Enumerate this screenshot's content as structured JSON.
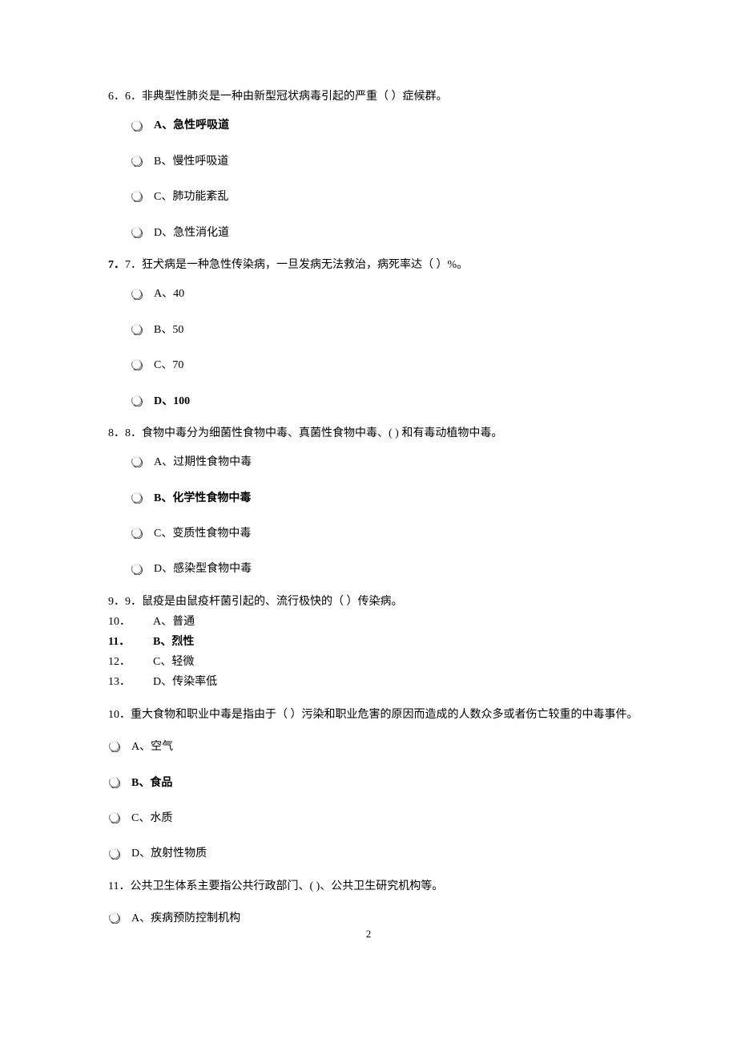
{
  "q6": {
    "text": "6．6．非典型性肺炎是一种由新型冠状病毒引起的严重（ ）症候群。",
    "options": [
      {
        "label": "A、急性呼吸道",
        "bold": true
      },
      {
        "label": "B、慢性呼吸道",
        "bold": false
      },
      {
        "label": "C、肺功能紊乱",
        "bold": false
      },
      {
        "label": "D、急性消化道",
        "bold": false
      }
    ]
  },
  "q7": {
    "text": "7．7．狂犬病是一种急性传染病，一旦发病无法救治，病死率达（  ）%。",
    "options": [
      {
        "label": "A、40",
        "bold": false
      },
      {
        "label": "B、50",
        "bold": false
      },
      {
        "label": "C、70",
        "bold": false
      },
      {
        "label": "D、100",
        "bold": true
      }
    ]
  },
  "q8": {
    "text": "8．8．食物中毒分为细菌性食物中毒、真菌性食物中毒、(   ) 和有毒动植物中毒。",
    "options": [
      {
        "label": "A、过期性食物中毒",
        "bold": false
      },
      {
        "label": "B、化学性食物中毒",
        "bold": true
      },
      {
        "label": "C、变质性食物中毒",
        "bold": false
      },
      {
        "label": "D、感染型食物中毒",
        "bold": false
      }
    ]
  },
  "q9": {
    "text": "9．9．鼠疫是由鼠疫杆菌引起的、流行极快的（  ）传染病。",
    "lines": [
      {
        "num": "10．",
        "text": "A、普通",
        "bold": false
      },
      {
        "num": "11．",
        "text": "B、烈性",
        "bold": true
      },
      {
        "num": "12．",
        "text": "C、轻微",
        "bold": false
      },
      {
        "num": "13．",
        "text": "D、传染率低",
        "bold": false
      }
    ]
  },
  "q10": {
    "text": "10．重大食物和职业中毒是指由于（  ）污染和职业危害的原因而造成的人数众多或者伤亡较重的中毒事件。",
    "options": [
      {
        "label": "A、空气",
        "bold": false
      },
      {
        "label": "B、食品",
        "bold": true
      },
      {
        "label": "C、水质",
        "bold": false
      },
      {
        "label": "D、放射性物质",
        "bold": false
      }
    ]
  },
  "q11": {
    "text": "11．公共卫生体系主要指公共行政部门、( )、公共卫生研究机构等。",
    "options": [
      {
        "label": "A、疾病预防控制机构",
        "bold": false
      }
    ]
  },
  "pageNumber": "2"
}
